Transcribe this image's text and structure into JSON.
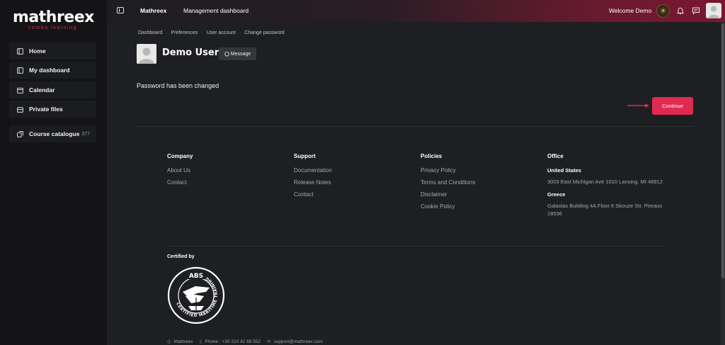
{
  "brand": {
    "name": "mathreex",
    "tagline": "combo learning"
  },
  "sidebar": {
    "items": [
      {
        "label": "Home",
        "icon": "home-icon"
      },
      {
        "label": "My dashboard",
        "icon": "dashboard-icon"
      },
      {
        "label": "Calendar",
        "icon": "calendar-icon"
      },
      {
        "label": "Private files",
        "icon": "files-icon"
      }
    ],
    "catalogue": {
      "label": "Course catalogue",
      "count": "377",
      "icon": "catalogue-icon"
    }
  },
  "topbar": {
    "site": "Mathreex",
    "nav": "Management dashboard",
    "welcome": "Welcome Demo"
  },
  "breadcrumb": [
    "Dashboard",
    "Preferences",
    "User account",
    "Change password"
  ],
  "user": {
    "name": "Demo User",
    "message_label": "Message"
  },
  "notice": "Password has been changed",
  "continue_label": "Continue",
  "footer": {
    "company": {
      "title": "Company",
      "links": [
        "About Us",
        "Contact"
      ]
    },
    "support": {
      "title": "Support",
      "links": [
        "Documentation",
        "Release Notes",
        "Contact"
      ]
    },
    "policies": {
      "title": "Policies",
      "links": [
        "Privacy Policy",
        "Terms and Conditions",
        "Disclaimer",
        "Cookie Policy"
      ]
    },
    "office": {
      "title": "Office",
      "us_label": "United States",
      "us_address": "3003 East Michigan Ave 1010 Lansing, MI 48912",
      "gr_label": "Greece",
      "gr_address": "Galaxias Building 4A Floor 6 Skouze Str. Pireaus 18536"
    },
    "certified_label": "Certified by",
    "badge": {
      "top": "ABS",
      "ring": "CERTIFIED MARITIME TRAINING"
    },
    "bottom": {
      "site": "Mathreex",
      "phone": "Phone : +30 210 42 86 552",
      "email": "support@mathreex.com"
    }
  },
  "colors": {
    "accent": "#e02a50",
    "sidebar_bg": "#141416",
    "main_bg": "#1e1f23",
    "topbar_end": "#7a1730"
  }
}
